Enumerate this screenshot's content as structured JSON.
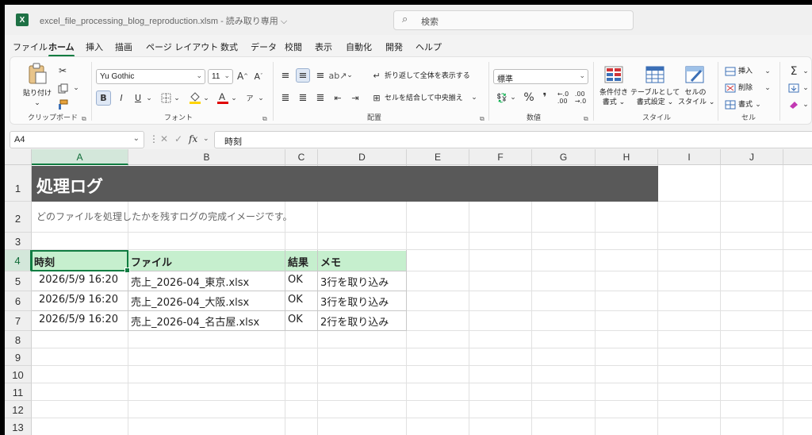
{
  "window": {
    "file_title": "excel_file_processing_blog_reproduction.xlsm  ‐  読み取り専用 ⌵",
    "app_badge": "X",
    "search_placeholder": "検索"
  },
  "menu_tabs": [
    "ファイル",
    "ホーム",
    "挿入",
    "描画",
    "ページ レイアウト",
    "数式",
    "データ",
    "校閲",
    "表示",
    "自動化",
    "開発",
    "ヘルプ"
  ],
  "active_tab": "ホーム",
  "ribbon": {
    "clipboard": {
      "paste_label": "貼り付け",
      "group_label": "クリップボード"
    },
    "font": {
      "font_name": "Yu Gothic",
      "font_size": "11",
      "group_label": "フォント",
      "bold": "B",
      "italic": "I",
      "underline": "U"
    },
    "alignment": {
      "wrap_label": "折り返して全体を表示する",
      "merge_label": "セルを結合して中央揃え",
      "group_label": "配置"
    },
    "number": {
      "format": "標準",
      "group_label": "数値",
      "percent": "%",
      "comma": "❜"
    },
    "styles": {
      "cond_format_label": "条件付き\n書式 ⌄",
      "table_format_label": "テーブルとして\n書式設定 ⌄",
      "cell_styles_label": "セルの\nスタイル ⌄",
      "group_label": "スタイル"
    },
    "cells": {
      "insert_label": "挿入",
      "delete_label": "削除",
      "format_label": "書式",
      "group_label": "セル"
    },
    "editing": {
      "sum": "Σ"
    },
    "accent_color": "#107c41"
  },
  "formula_bar": {
    "name_box": "A4",
    "fx": "fx",
    "content": "時刻"
  },
  "columns": [
    "A",
    "B",
    "C",
    "D",
    "E",
    "F",
    "G",
    "H",
    "I",
    "J"
  ],
  "rows": [
    "1",
    "2",
    "3",
    "4",
    "5",
    "6",
    "7",
    "8",
    "9",
    "10",
    "11",
    "12",
    "13"
  ],
  "sheet": {
    "title": "処理ログ",
    "subtitle": "どのファイルを処理したかを残すログの完成イメージです。",
    "headers": [
      "時刻",
      "ファイル",
      "結果",
      "メモ"
    ],
    "rows": [
      [
        "2026/5/9 16:20",
        "売上_2026-04_東京.xlsx",
        "OK",
        "3行を取り込み"
      ],
      [
        "2026/5/9 16:20",
        "売上_2026-04_大阪.xlsx",
        "OK",
        "3行を取り込み"
      ],
      [
        "2026/5/9 16:20",
        "売上_2026-04_名古屋.xlsx",
        "OK",
        "2行を取り込み"
      ]
    ],
    "title_fill": "#595959",
    "header_fill": "#c6efce"
  }
}
